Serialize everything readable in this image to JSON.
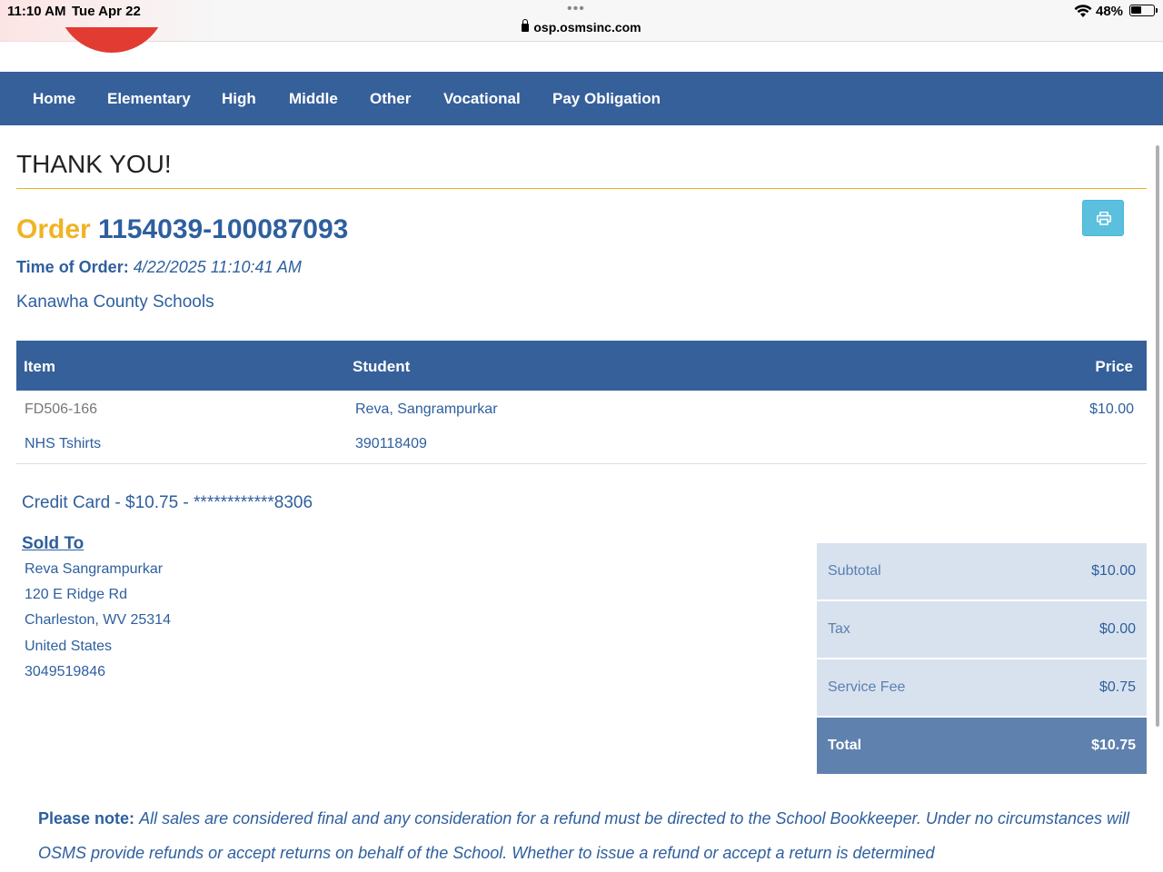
{
  "status_bar": {
    "time": "11:10 AM",
    "date": "Tue Apr 22",
    "dots": "•••",
    "url": "osp.osmsinc.com",
    "battery": "48%"
  },
  "nav": {
    "items": [
      "Home",
      "Elementary",
      "High",
      "Middle",
      "Other",
      "Vocational",
      "Pay Obligation"
    ]
  },
  "page": {
    "title": "THANK YOU!",
    "order_word": "Order",
    "order_number": "1154039-100087093",
    "time_label": "Time of Order:",
    "time_value": "4/22/2025 11:10:41 AM",
    "district": "Kanawha County Schools"
  },
  "table": {
    "headers": [
      "Item",
      "Student",
      "Price"
    ],
    "row": {
      "item_code": "FD506-166",
      "item_name": "NHS Tshirts",
      "student_name": "Reva, Sangrampurkar",
      "student_id": "390118409",
      "price": "$10.00"
    }
  },
  "payment": {
    "line": "Credit Card - $10.75 - ************8306"
  },
  "sold_to": {
    "title": "Sold To",
    "name": "Reva Sangrampurkar",
    "street": "120 E Ridge Rd",
    "city": "Charleston, WV 25314",
    "country": "United States",
    "phone": "3049519846"
  },
  "totals": {
    "subtotal_label": "Subtotal",
    "subtotal": "$10.00",
    "tax_label": "Tax",
    "tax": "$0.00",
    "fee_label": "Service Fee",
    "fee": "$0.75",
    "total_label": "Total",
    "total": "$10.75"
  },
  "note": {
    "label": "Please note:",
    "text": "All sales are considered final and any consideration for a refund must be directed to the School Bookkeeper. Under no circumstances will OSMS provide refunds or accept returns on behalf of the School. Whether to issue a refund or accept a return is determined"
  },
  "colors": {
    "nav_bg": "#36609a",
    "accent_gold": "#f0b323",
    "link_blue": "#2e5f9e",
    "print_button": "#5bc0de"
  },
  "icons": {
    "print": "printer-icon",
    "lock": "lock-icon",
    "wifi": "wifi-icon",
    "battery": "battery-icon"
  }
}
